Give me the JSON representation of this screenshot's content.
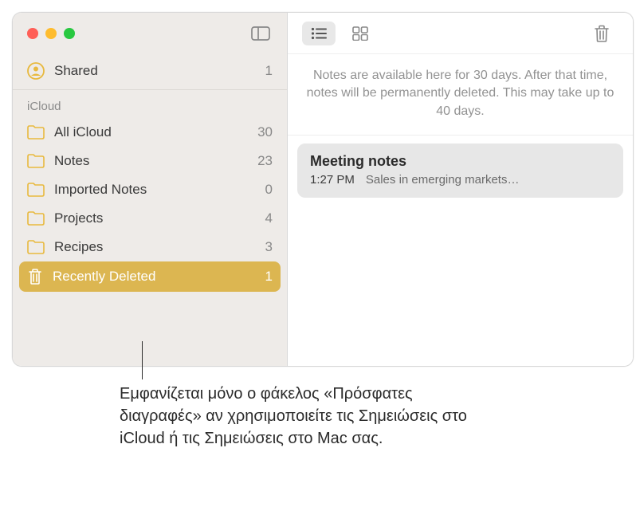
{
  "sidebar": {
    "shared": {
      "label": "Shared",
      "count": "1"
    },
    "section": "iCloud",
    "folders": [
      {
        "label": "All iCloud",
        "count": "30"
      },
      {
        "label": "Notes",
        "count": "23"
      },
      {
        "label": "Imported Notes",
        "count": "0"
      },
      {
        "label": "Projects",
        "count": "4"
      },
      {
        "label": "Recipes",
        "count": "3"
      },
      {
        "label": "Recently Deleted",
        "count": "1"
      }
    ]
  },
  "main": {
    "notice": "Notes are available here for 30 days. After that time, notes will be permanently deleted. This may take up to 40 days.",
    "note": {
      "title": "Meeting notes",
      "time": "1:27 PM",
      "preview": "Sales in emerging markets…"
    }
  },
  "callout": "Εμφανίζεται μόνο ο φάκελος «Πρόσφατες διαγραφές» αν χρησιμοποιείτε τις Σημειώσεις στο iCloud ή τις Σημειώσεις στο Mac σας."
}
